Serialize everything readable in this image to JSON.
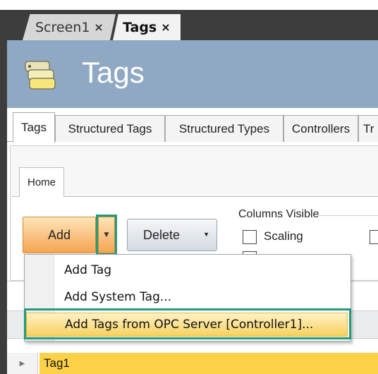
{
  "doc_tabs": [
    {
      "label": "Screen1",
      "close": "×"
    },
    {
      "label": "Tags",
      "close": "×"
    }
  ],
  "header": {
    "title": "Tags",
    "icon": "tags-icon"
  },
  "editor_tabs": [
    "Tags",
    "Structured Tags",
    "Structured Types",
    "Controllers",
    "Tr"
  ],
  "ribbon": {
    "tab": "Home",
    "add_label": "Add",
    "delete_label": "Delete",
    "columns_visible": {
      "label": "Columns Visible",
      "options": [
        {
          "label": "Scaling",
          "checked": false
        }
      ]
    }
  },
  "add_menu": {
    "items": [
      "Add Tag",
      "Add System Tag...",
      "Add Tags from OPC Server [Controller1]..."
    ],
    "highlighted_index": 2
  },
  "grid": {
    "rows": [
      {
        "name": "Tag1"
      }
    ]
  },
  "colors": {
    "header_bg": "#8fa9c4",
    "add_button": "#f6a453",
    "row_highlight": "#fed248",
    "annotation_outline": "#239b7a"
  }
}
